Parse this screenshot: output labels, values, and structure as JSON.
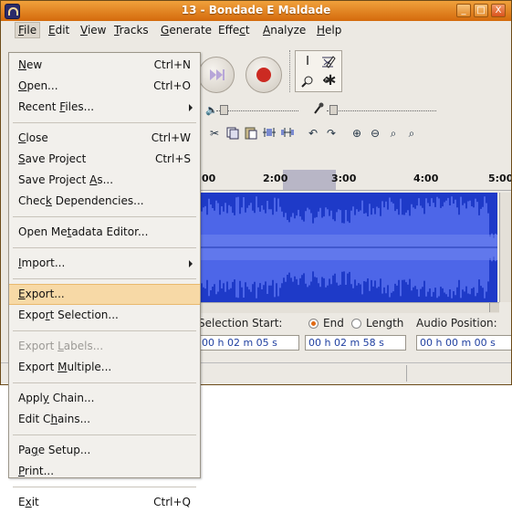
{
  "window": {
    "title": "13 - Bondade E Maldade",
    "buttons": [
      "_",
      "□",
      "X"
    ]
  },
  "menubar": {
    "items": [
      "File",
      "Edit",
      "View",
      "Tracks",
      "Generate",
      "Effect",
      "Analyze",
      "Help"
    ]
  },
  "toolbar": {
    "tools": [
      "I",
      "✳",
      "↔",
      "⌕",
      "∗"
    ],
    "edit_icons": [
      "cut-icon",
      "copy-icon",
      "paste-icon",
      "trim-icon",
      "silence-icon",
      "undo-icon",
      "redo-icon",
      "zoom-in-icon",
      "zoom-out-icon",
      "fit-selection-icon",
      "fit-project-icon"
    ]
  },
  "ruler": {
    "ticks": [
      "00",
      "2:00",
      "3:00",
      "4:00",
      "5:00"
    ]
  },
  "selection_bar": {
    "selection_start_label": "Selection Start:",
    "end_label": "End",
    "length_label": "Length",
    "audio_position_label": "Audio Position:",
    "selection_start_value": "00 h 02 m 05 s",
    "end_value": "00 h 02 m 58 s",
    "audio_position_value": "00 h 00 m 00 s",
    "end_selected": true
  },
  "file_menu": {
    "items": [
      {
        "label": "New",
        "accel": "Ctrl+N"
      },
      {
        "label": "Open...",
        "accel": "Ctrl+O"
      },
      {
        "label": "Recent Files...",
        "accel": "",
        "submenu": true
      },
      {
        "separator": true
      },
      {
        "label": "Close",
        "accel": "Ctrl+W"
      },
      {
        "label": "Save Project",
        "accel": "Ctrl+S"
      },
      {
        "label": "Save Project As...",
        "accel": ""
      },
      {
        "label": "Check Dependencies...",
        "accel": ""
      },
      {
        "separator": true
      },
      {
        "label": "Open Metadata Editor...",
        "accel": ""
      },
      {
        "separator": true
      },
      {
        "label": "Import...",
        "accel": "",
        "submenu": true
      },
      {
        "separator": true
      },
      {
        "label": "Export...",
        "accel": "",
        "highlighted": true
      },
      {
        "label": "Export Selection...",
        "accel": ""
      },
      {
        "separator": true
      },
      {
        "label": "Export Labels...",
        "accel": "",
        "disabled": true
      },
      {
        "label": "Export Multiple...",
        "accel": ""
      },
      {
        "separator": true
      },
      {
        "label": "Apply Chain...",
        "accel": ""
      },
      {
        "label": "Edit Chains...",
        "accel": ""
      },
      {
        "separator": true
      },
      {
        "label": "Page Setup...",
        "accel": ""
      },
      {
        "label": "Print...",
        "accel": ""
      },
      {
        "separator": true
      },
      {
        "label": "Exit",
        "accel": "Ctrl+Q"
      }
    ]
  },
  "colors": {
    "titlebar": "#d97a1c",
    "waveform": "#1e3ac8",
    "menu_highlight": "#f7d9a6"
  }
}
